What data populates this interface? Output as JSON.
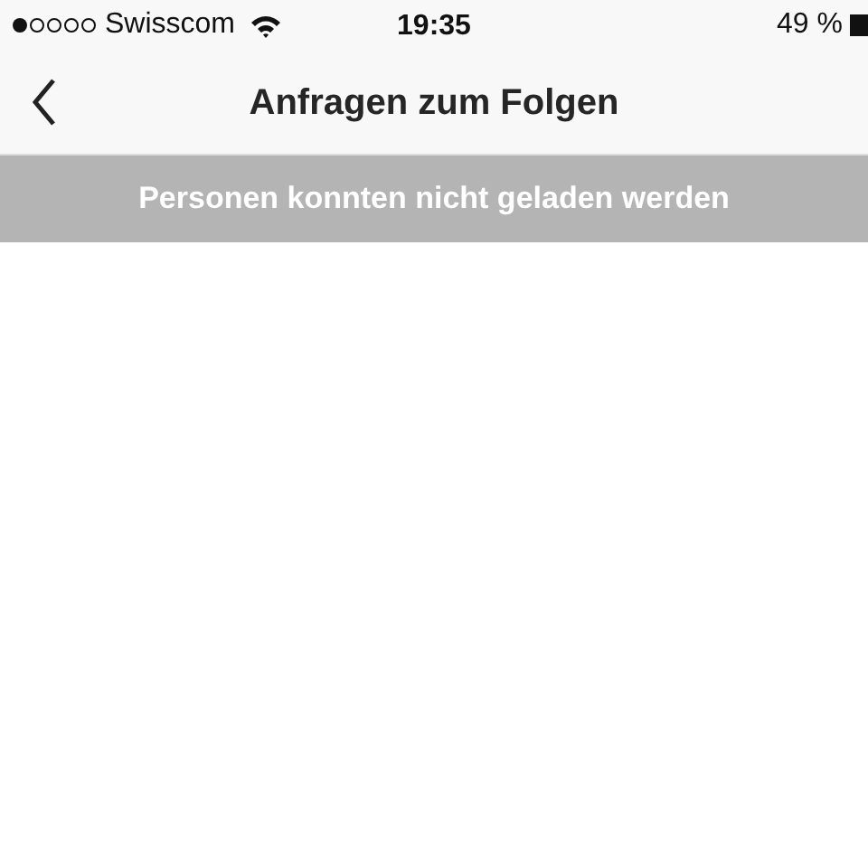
{
  "status_bar": {
    "carrier": "Swisscom",
    "time": "19:35",
    "battery": "49 %"
  },
  "nav_bar": {
    "title": "Anfragen zum Folgen"
  },
  "banner": {
    "text": "Personen konnten nicht geladen werden"
  }
}
